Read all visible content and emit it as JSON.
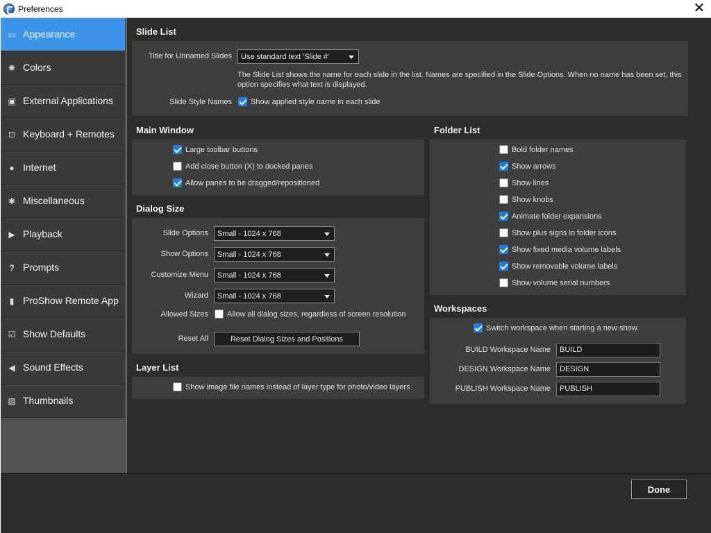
{
  "window": {
    "title": "Preferences"
  },
  "sidebar": {
    "items": [
      {
        "label": "Appearance",
        "icon": "appearance-icon"
      },
      {
        "label": "Colors",
        "icon": "colors-icon"
      },
      {
        "label": "External Applications",
        "icon": "external-apps-icon"
      },
      {
        "label": "Keyboard + Remotes",
        "icon": "keyboard-icon"
      },
      {
        "label": "Internet",
        "icon": "globe-icon"
      },
      {
        "label": "Miscellaneous",
        "icon": "gear-icon"
      },
      {
        "label": "Playback",
        "icon": "play-icon"
      },
      {
        "label": "Prompts",
        "icon": "question-icon"
      },
      {
        "label": "ProShow Remote App",
        "icon": "remote-icon"
      },
      {
        "label": "Show Defaults",
        "icon": "checkbox-icon"
      },
      {
        "label": "Sound Effects",
        "icon": "speaker-icon"
      },
      {
        "label": "Thumbnails",
        "icon": "thumbnail-icon"
      }
    ],
    "selected": "Appearance",
    "accent_color": "#3c94e8"
  },
  "slide_list": {
    "title": "Slide List",
    "unnamed_label": "Title for Unnamed Slides",
    "unnamed_value": "Use standard text 'Slide #'",
    "description": "The Slide List shows the name for each slide in the list. Names are specified in the Slide Options. When no name has been set, this",
    "description_2": "option specifies what text is displayed.",
    "style_names_label": "Slide Style Names",
    "style_names_checkbox": "Show applied style name in each slide",
    "style_names_checked": true
  },
  "main_window": {
    "title": "Main Window",
    "options": [
      {
        "label": "Large toolbar buttons",
        "checked": true
      },
      {
        "label": "Add close button (X) to docked panes",
        "checked": false
      },
      {
        "label": "Allow panes to be dragged/repositioned",
        "checked": true
      }
    ]
  },
  "dialog_size": {
    "title": "Dialog Size",
    "rows": [
      {
        "label": "Slide Options",
        "value": "Small - 1024 x 768"
      },
      {
        "label": "Show Options",
        "value": "Small - 1024 x 768"
      },
      {
        "label": "Customize Menu",
        "value": "Small - 1024 x 768"
      },
      {
        "label": "Wizard",
        "value": "Small - 1024 x 768"
      }
    ],
    "allowed_label": "Allowed Sizes",
    "allowed_checkbox": "Allow all dialog sizes, regardless of screen resolution",
    "allowed_checked": false,
    "reset_label": "Reset All",
    "reset_button": "Reset Dialog Sizes and Positions"
  },
  "layer_list": {
    "title": "Layer List",
    "checkbox": "Show image file names instead of layer type for photo/video layers",
    "checked": false
  },
  "folder_list": {
    "title": "Folder List",
    "options": [
      {
        "label": "Bold folder names",
        "checked": false
      },
      {
        "label": "Show arrows",
        "checked": true
      },
      {
        "label": "Show lines",
        "checked": false
      },
      {
        "label": "Show knobs",
        "checked": false
      },
      {
        "label": "Animate folder expansions",
        "checked": true
      },
      {
        "label": "Show plus signs in folder icons",
        "checked": false
      },
      {
        "label": "Show fixed media volume labels",
        "checked": true
      },
      {
        "label": "Show removable volume labels",
        "checked": true
      },
      {
        "label": "Show volume serial numbers",
        "checked": false
      }
    ]
  },
  "workspaces": {
    "title": "Workspaces",
    "switch_checkbox": "Switch workspace when starting a new show.",
    "switch_checked": true,
    "build_label": "BUILD Workspace Name",
    "build_value": "BUILD",
    "design_label": "DESIGN Workspace Name",
    "design_value": "DESIGN",
    "publish_label": "PUBLISH Workspace Name",
    "publish_value": "PUBLISH"
  },
  "footer": {
    "done_label": "Done"
  }
}
